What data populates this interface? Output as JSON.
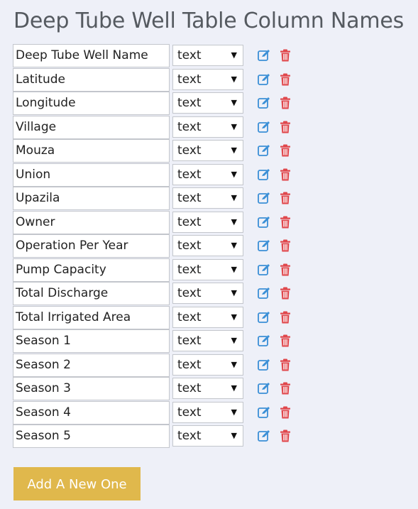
{
  "page": {
    "title": "Deep Tube Well Table Column Names"
  },
  "columns": [
    {
      "name": "Deep Tube Well Name",
      "type": "text"
    },
    {
      "name": "Latitude",
      "type": "text"
    },
    {
      "name": "Longitude",
      "type": "text"
    },
    {
      "name": "Village",
      "type": "text"
    },
    {
      "name": "Mouza",
      "type": "text"
    },
    {
      "name": "Union",
      "type": "text"
    },
    {
      "name": "Upazila",
      "type": "text"
    },
    {
      "name": "Owner",
      "type": "text"
    },
    {
      "name": "Operation Per Year",
      "type": "text"
    },
    {
      "name": "Pump Capacity",
      "type": "text"
    },
    {
      "name": "Total Discharge",
      "type": "text"
    },
    {
      "name": "Total Irrigated Area",
      "type": "text"
    },
    {
      "name": "Season 1",
      "type": "text"
    },
    {
      "name": "Season 2",
      "type": "text"
    },
    {
      "name": "Season 3",
      "type": "text"
    },
    {
      "name": "Season 4",
      "type": "text"
    },
    {
      "name": "Season 5",
      "type": "text"
    }
  ],
  "icons": {
    "edit": "edit-icon",
    "delete": "trash-icon",
    "dropdown": "caret-down-icon"
  },
  "colors": {
    "background": "#eef0f8",
    "edit_icon": "#3b8fd6",
    "delete_icon": "#e0474c",
    "add_button": "#e0b84c"
  },
  "actions": {
    "add_label": "Add A New One"
  }
}
